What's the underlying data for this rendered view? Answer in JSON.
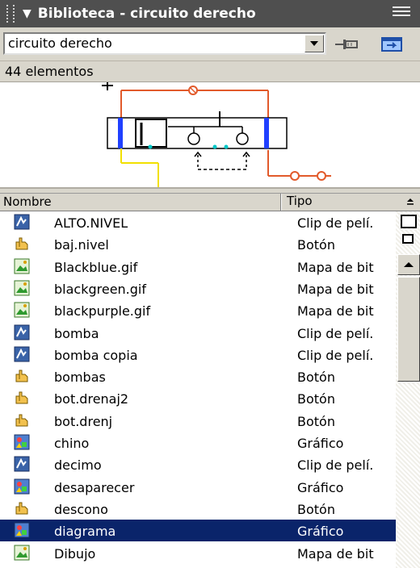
{
  "panel": {
    "title": "Biblioteca - circuito derecho",
    "collapse_glyph": "▼",
    "options_icon": "options-menu-icon"
  },
  "toolbar": {
    "library_select_value": "circuito derecho",
    "pin_icon": "pin-icon",
    "new_panel_icon": "new-library-panel-icon"
  },
  "count_label": "44 elementos",
  "columns": {
    "name": "Nombre",
    "type": "Tipo"
  },
  "items": [
    {
      "name": "ALTO.NIVEL",
      "type": "Clip de pelí.",
      "icon": "movieclip-icon"
    },
    {
      "name": "baj.nivel",
      "type": "Botón",
      "icon": "button-icon"
    },
    {
      "name": "Blackblue.gif",
      "type": "Mapa de bit",
      "icon": "bitmap-icon"
    },
    {
      "name": "blackgreen.gif",
      "type": "Mapa de bit",
      "icon": "bitmap-icon"
    },
    {
      "name": "blackpurple.gif",
      "type": "Mapa de bit",
      "icon": "bitmap-icon"
    },
    {
      "name": "bomba",
      "type": "Clip de pelí.",
      "icon": "movieclip-icon"
    },
    {
      "name": "bomba copia",
      "type": "Clip de pelí.",
      "icon": "movieclip-icon"
    },
    {
      "name": "bombas",
      "type": "Botón",
      "icon": "button-icon"
    },
    {
      "name": "bot.drenaj2",
      "type": "Botón",
      "icon": "button-icon"
    },
    {
      "name": "bot.drenj",
      "type": "Botón",
      "icon": "button-icon"
    },
    {
      "name": "chino",
      "type": "Gráfico",
      "icon": "graphic-icon"
    },
    {
      "name": "decimo",
      "type": "Clip de pelí.",
      "icon": "movieclip-icon"
    },
    {
      "name": "desaparecer",
      "type": "Gráfico",
      "icon": "graphic-icon"
    },
    {
      "name": "descono",
      "type": "Botón",
      "icon": "button-icon"
    },
    {
      "name": "diagrama",
      "type": "Gráfico",
      "icon": "graphic-icon",
      "selected": true
    },
    {
      "name": "Dibujo",
      "type": "Mapa de bit",
      "icon": "bitmap-icon"
    }
  ],
  "colors": {
    "titlebar": "#4f4f4f",
    "panel_gray": "#d9d6cc",
    "selection": "#0a246a",
    "preview_red": "#e25a2b",
    "preview_yellow": "#f2e000",
    "preview_blue": "#2040ff"
  }
}
